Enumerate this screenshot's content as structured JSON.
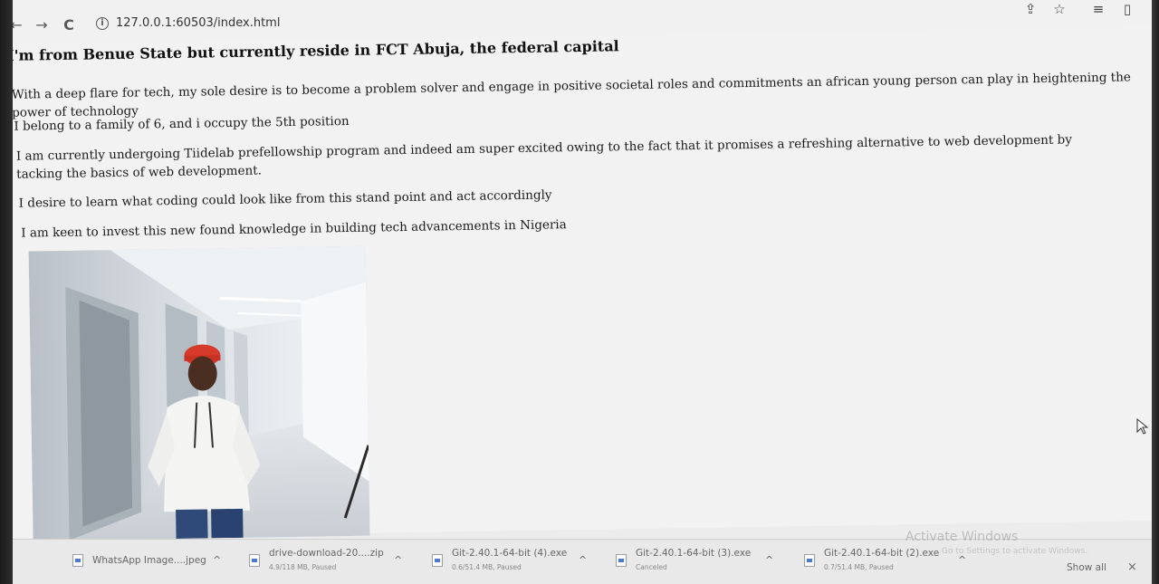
{
  "browser": {
    "url": "127.0.0.1:60503/index.html"
  },
  "page": {
    "heading": "I'm from Benue State but currently reside in FCT Abuja, the federal capital",
    "paragraphs": [
      "With a deep flare for tech, my sole desire is to become a problem solver and engage in positive societal roles and commitments an african young person can play in heightening the power of technology",
      "I belong to a family of 6, and i occupy the 5th position",
      "I am currently undergoing Tiidelab prefellowship program and indeed am super excited owing to the fact that it promises a refreshing alternative to web development by tacking the basics of web development.",
      "I desire to learn what coding could look like from this stand point and act accordingly",
      "I am keen to invest this new found knowledge in building tech advancements in Nigeria"
    ]
  },
  "downloads": {
    "items": [
      {
        "name": "WhatsApp Image....jpeg",
        "status": ""
      },
      {
        "name": "drive-download-20....zip",
        "status": "4.9/118 MB, Paused"
      },
      {
        "name": "Git-2.40.1-64-bit (4).exe",
        "status": "0.6/51.4 MB, Paused"
      },
      {
        "name": "Git-2.40.1-64-bit (3).exe",
        "status": "Canceled"
      },
      {
        "name": "Git-2.40.1-64-bit (2).exe",
        "status": "0.7/51.4 MB, Paused"
      }
    ],
    "show_all": "Show all",
    "close": "×"
  },
  "watermark": {
    "title": "Activate Windows",
    "subtitle": "Go to Settings to activate Windows."
  },
  "icons": {
    "back": "←",
    "forward": "→",
    "reload": "C",
    "info": "i",
    "share": "⇪",
    "star": "☆",
    "reading_list": "≡",
    "side_panel": "▯",
    "chevron_up": "^"
  }
}
